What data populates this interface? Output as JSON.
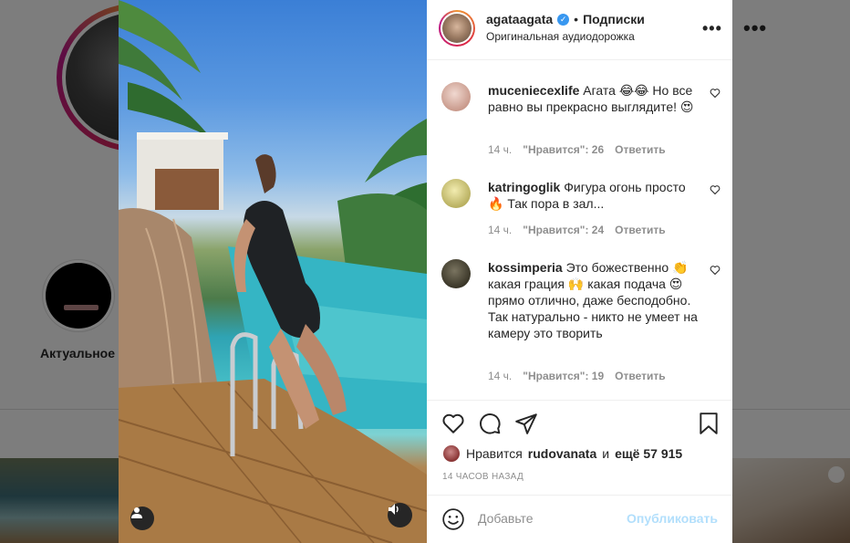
{
  "background": {
    "highlight_label": "Актуальное",
    "more_icon": "more-horizontal-icon"
  },
  "post": {
    "username": "agataagata",
    "verified": true,
    "separator": "•",
    "follow_status": "Подписки",
    "audio": "Оригинальная аудиодорожка",
    "more_icon": "more-horizontal-icon"
  },
  "comments": [
    {
      "username": "muceniecexlife",
      "text": "Агата 😂😂 Но все равно вы прекрасно выглядите! 😍",
      "time": "14 ч.",
      "likes": "\"Нравится\": 26",
      "reply": "Ответить",
      "avatar_color": "#e9c9c0"
    },
    {
      "username": "katringoglik",
      "text": "Фигура огонь просто 🔥 Так пора в зал...",
      "time": "14 ч.",
      "likes": "\"Нравится\": 24",
      "reply": "Ответить",
      "avatar_color": "#d8d28a"
    },
    {
      "username": "kossimperia",
      "text": "Это божественно 👏 какая грация 🙌 какая подача 😍 прямо отлично, даже бесподобно. Так натурально - никто не умеет на камеру это творить",
      "time": "14 ч.",
      "likes": "\"Нравится\": 19",
      "reply": "Ответить",
      "avatar_color": "#4a4636"
    }
  ],
  "actions": {
    "like_icon": "heart-icon",
    "comment_icon": "comment-icon",
    "share_icon": "share-icon",
    "save_icon": "bookmark-icon",
    "likes_prefix": "Нравится",
    "likes_user": "rudovanata",
    "likes_and": "и",
    "likes_rest": "ещё 57 915",
    "timestamp": "14 ЧАСОВ НАЗАД"
  },
  "add_comment": {
    "emoji_icon": "emoji-icon",
    "placeholder": "Добавьте",
    "publish": "Опубликовать"
  },
  "colors": {
    "link_blue": "#0095f6",
    "publish_disabled": "#b2dffc",
    "verified_blue": "#3897f0",
    "meta_gray": "#8e8e8e"
  }
}
